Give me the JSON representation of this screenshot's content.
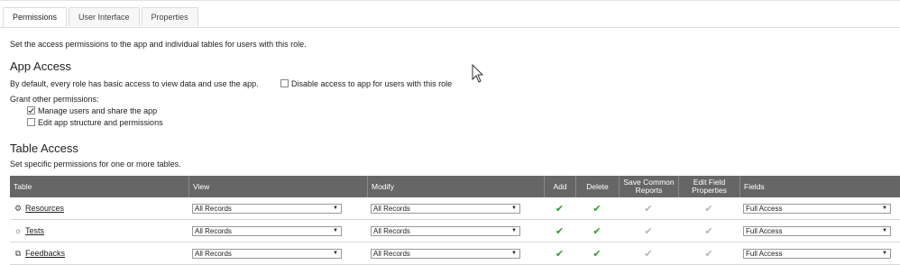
{
  "tabs": [
    {
      "label": "Permissions"
    },
    {
      "label": "User Interface"
    },
    {
      "label": "Properties"
    }
  ],
  "intro": "Set the access permissions to the app and individual tables for users with this role.",
  "app_access": {
    "heading": "App Access",
    "default_text": "By default, every role has basic access to view data and use the app.",
    "disable_label": "Disable access to app for users with this role",
    "grant_label": "Grant other permissions:",
    "manage_label": "Manage users and share the app",
    "edit_label": "Edit app structure and permissions"
  },
  "table_access": {
    "heading": "Table Access",
    "subtext": "Set specific permissions for one or more tables.",
    "headers": {
      "table": "Table",
      "view": "View",
      "modify": "Modify",
      "add": "Add",
      "delete": "Delete",
      "save_reports": "Save Common Reports",
      "edit_field": "Edit Field Properties",
      "fields": "Fields"
    },
    "rows": [
      {
        "name": "Resources",
        "icon": "resources-icon",
        "view": "All Records",
        "modify": "All Records",
        "fields": "Full Access"
      },
      {
        "name": "Tests",
        "icon": "tests-icon",
        "view": "All Records",
        "modify": "All Records",
        "fields": "Full Access"
      },
      {
        "name": "Feedbacks",
        "icon": "feedbacks-icon",
        "view": "All Records",
        "modify": "All Records",
        "fields": "Full Access"
      }
    ]
  },
  "colors": {
    "header_bg": "#666666",
    "check_green": "#2e9a2e",
    "check_grey": "#b5b5b5"
  }
}
